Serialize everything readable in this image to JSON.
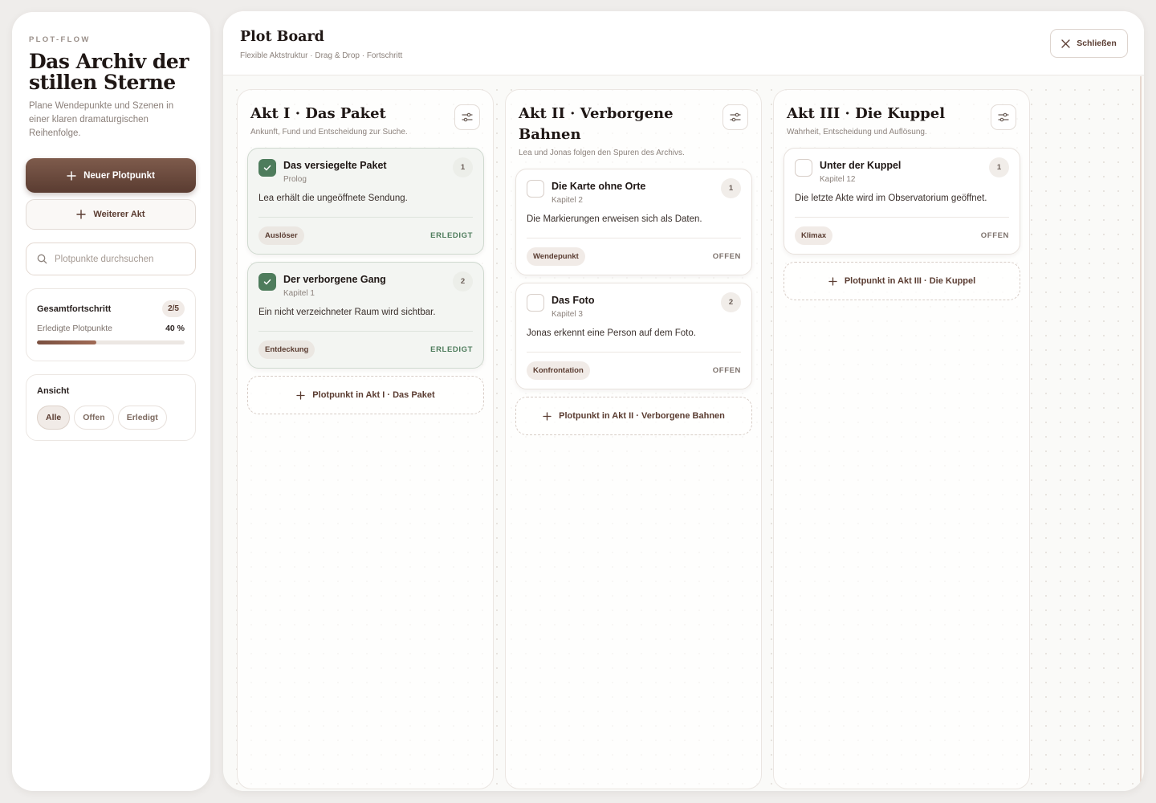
{
  "sidebar": {
    "brand": "PLOT-FLOW",
    "book_title": "Das Archiv der stillen Sterne",
    "description": "Plane Wendepunkte und Szenen in einer klaren dramaturgischen Reihenfolge.",
    "new_plot_button": "Neuer Plotpunkt",
    "new_act_button": "Weiterer Akt",
    "search_placeholder": "Plotpunkte durchsuchen",
    "progress": {
      "title": "Gesamtfortschritt",
      "badge": "2/5",
      "label": "Erledigte Plotpunkte",
      "percent_text": "40 %",
      "fraction": 0.4
    },
    "view": {
      "title": "Ansicht",
      "options": [
        "Alle",
        "Offen",
        "Erledigt"
      ],
      "active": "Alle"
    }
  },
  "header": {
    "title": "Plot Board",
    "subtitle": "Flexible Aktstruktur · Drag & Drop · Fortschritt",
    "close_label": "Schließen"
  },
  "acts": [
    {
      "title": "Akt I · Das Paket",
      "description": "Ankunft, Fund und Entscheidung zur Suche.",
      "add_label": "Plotpunkt in Akt I · Das Paket",
      "cards": [
        {
          "title": "Das versiegelte Paket",
          "chapter": "Prolog",
          "number": "1",
          "description": "Lea erhält die ungeöffnete Sendung.",
          "tag": "Auslöser",
          "status": "ERLEDIGT",
          "done": true
        },
        {
          "title": "Der verborgene Gang",
          "chapter": "Kapitel 1",
          "number": "2",
          "description": "Ein nicht verzeichneter Raum wird sichtbar.",
          "tag": "Entdeckung",
          "status": "ERLEDIGT",
          "done": true
        }
      ]
    },
    {
      "title": "Akt II · Verborgene Bahnen",
      "description": "Lea und Jonas folgen den Spuren des Archivs.",
      "add_label": "Plotpunkt in Akt II · Verborgene Bahnen",
      "cards": [
        {
          "title": "Die Karte ohne Orte",
          "chapter": "Kapitel 2",
          "number": "1",
          "description": "Die Markierungen erweisen sich als Daten.",
          "tag": "Wendepunkt",
          "status": "OFFEN",
          "done": false
        },
        {
          "title": "Das Foto",
          "chapter": "Kapitel 3",
          "number": "2",
          "description": "Jonas erkennt eine Person auf dem Foto.",
          "tag": "Konfrontation",
          "status": "OFFEN",
          "done": false
        }
      ]
    },
    {
      "title": "Akt III · Die Kuppel",
      "description": "Wahrheit, Entscheidung und Auflösung.",
      "add_label": "Plotpunkt in Akt III · Die Kuppel",
      "cards": [
        {
          "title": "Unter der Kuppel",
          "chapter": "Kapitel 12",
          "number": "1",
          "description": "Die letzte Akte wird im Observatorium geöffnet.",
          "tag": "Klimax",
          "status": "OFFEN",
          "done": false
        }
      ]
    }
  ],
  "icons": {
    "plus": "plus-icon",
    "search": "search-icon",
    "close": "close-icon",
    "settings": "sliders-icon",
    "check": "check-icon"
  },
  "colors": {
    "accent_brown": "#5a3c31",
    "done_green": "#4e7c5c",
    "progress_fill": "#8a5a48"
  }
}
